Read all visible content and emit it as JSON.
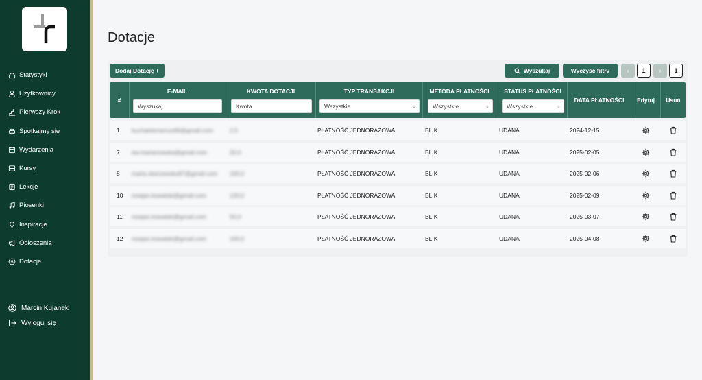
{
  "sidebar": {
    "items": [
      {
        "label": "Statystyki",
        "icon": "home-icon"
      },
      {
        "label": "Użytkownicy",
        "icon": "user-icon"
      },
      {
        "label": "Pierwszy Krok",
        "icon": "steps-icon"
      },
      {
        "label": "Spotkajmy się",
        "icon": "car-icon"
      },
      {
        "label": "Wydarzenia",
        "icon": "calendar-icon"
      },
      {
        "label": "Kursy",
        "icon": "courses-icon"
      },
      {
        "label": "Lekcje",
        "icon": "lesson-icon"
      },
      {
        "label": "Piosenki",
        "icon": "music-icon"
      },
      {
        "label": "Inspiracje",
        "icon": "bulb-icon"
      },
      {
        "label": "Ogłoszenia",
        "icon": "megaphone-icon"
      },
      {
        "label": "Dotacje",
        "icon": "coin-icon"
      }
    ],
    "user_name": "Marcin Kujanek",
    "logout_label": "Wyloguj się"
  },
  "page": {
    "title": "Dotacje"
  },
  "toolbar": {
    "add_label": "Dodaj Dotację +",
    "search_label": "Wyszukaj",
    "clear_label": "Wyczyść filtry",
    "prev_label": "‹",
    "next_label": "›",
    "current_page": "1",
    "total_pages": "1"
  },
  "table": {
    "headers": {
      "num": "#",
      "email": "E-MAIL",
      "amount": "KWOTA DOTACJI",
      "type": "TYP TRANSAKCJI",
      "method": "METODA PŁATNOŚCI",
      "status": "STATUS PŁATNOŚCI",
      "date": "DATA PŁATNOŚCI",
      "edit": "Edytuj",
      "delete": "Usuń"
    },
    "filters": {
      "email_placeholder": "Wyszukaj",
      "amount_placeholder": "Kwota",
      "type_value": "Wszystkie",
      "method_value": "Wszystkie",
      "status_value": "Wszystkie"
    },
    "rows": [
      {
        "num": "1",
        "email": "kuchatekmarcus99@gmail.com",
        "amount": "2,5",
        "type": "PŁATNOŚĆ JEDNORAZOWA",
        "method": "BLIK",
        "status": "UDANA",
        "date": "2024-12-15"
      },
      {
        "num": "7",
        "email": "ew.marianowska@gmail.com",
        "amount": "20,0",
        "type": "PŁATNOŚĆ JEDNORAZOWA",
        "method": "BLIK",
        "status": "UDANA",
        "date": "2025-02-05"
      },
      {
        "num": "8",
        "email": "marta.skarzewska97@gmail.com",
        "amount": "100,0",
        "type": "PŁATNOŚĆ JEDNORAZOWA",
        "method": "BLIK",
        "status": "UDANA",
        "date": "2025-02-06"
      },
      {
        "num": "10",
        "email": "nowjan.kowalski@gmail.com",
        "amount": "120,0",
        "type": "PŁATNOŚĆ JEDNORAZOWA",
        "method": "BLIK",
        "status": "UDANA",
        "date": "2025-02-09"
      },
      {
        "num": "11",
        "email": "nowjan.kowalski@gmail.com",
        "amount": "50,0",
        "type": "PŁATNOŚĆ JEDNORAZOWA",
        "method": "BLIK",
        "status": "UDANA",
        "date": "2025-03-07"
      },
      {
        "num": "12",
        "email": "nowjan.kowalski@gmail.com",
        "amount": "100,0",
        "type": "PŁATNOŚĆ JEDNORAZOWA",
        "method": "BLIK",
        "status": "UDANA",
        "date": "2025-04-08"
      }
    ]
  },
  "colors": {
    "sidebar_bg": "#0d3b2e",
    "accent": "#2e6b5b",
    "page_bg": "#f5f6f8"
  }
}
